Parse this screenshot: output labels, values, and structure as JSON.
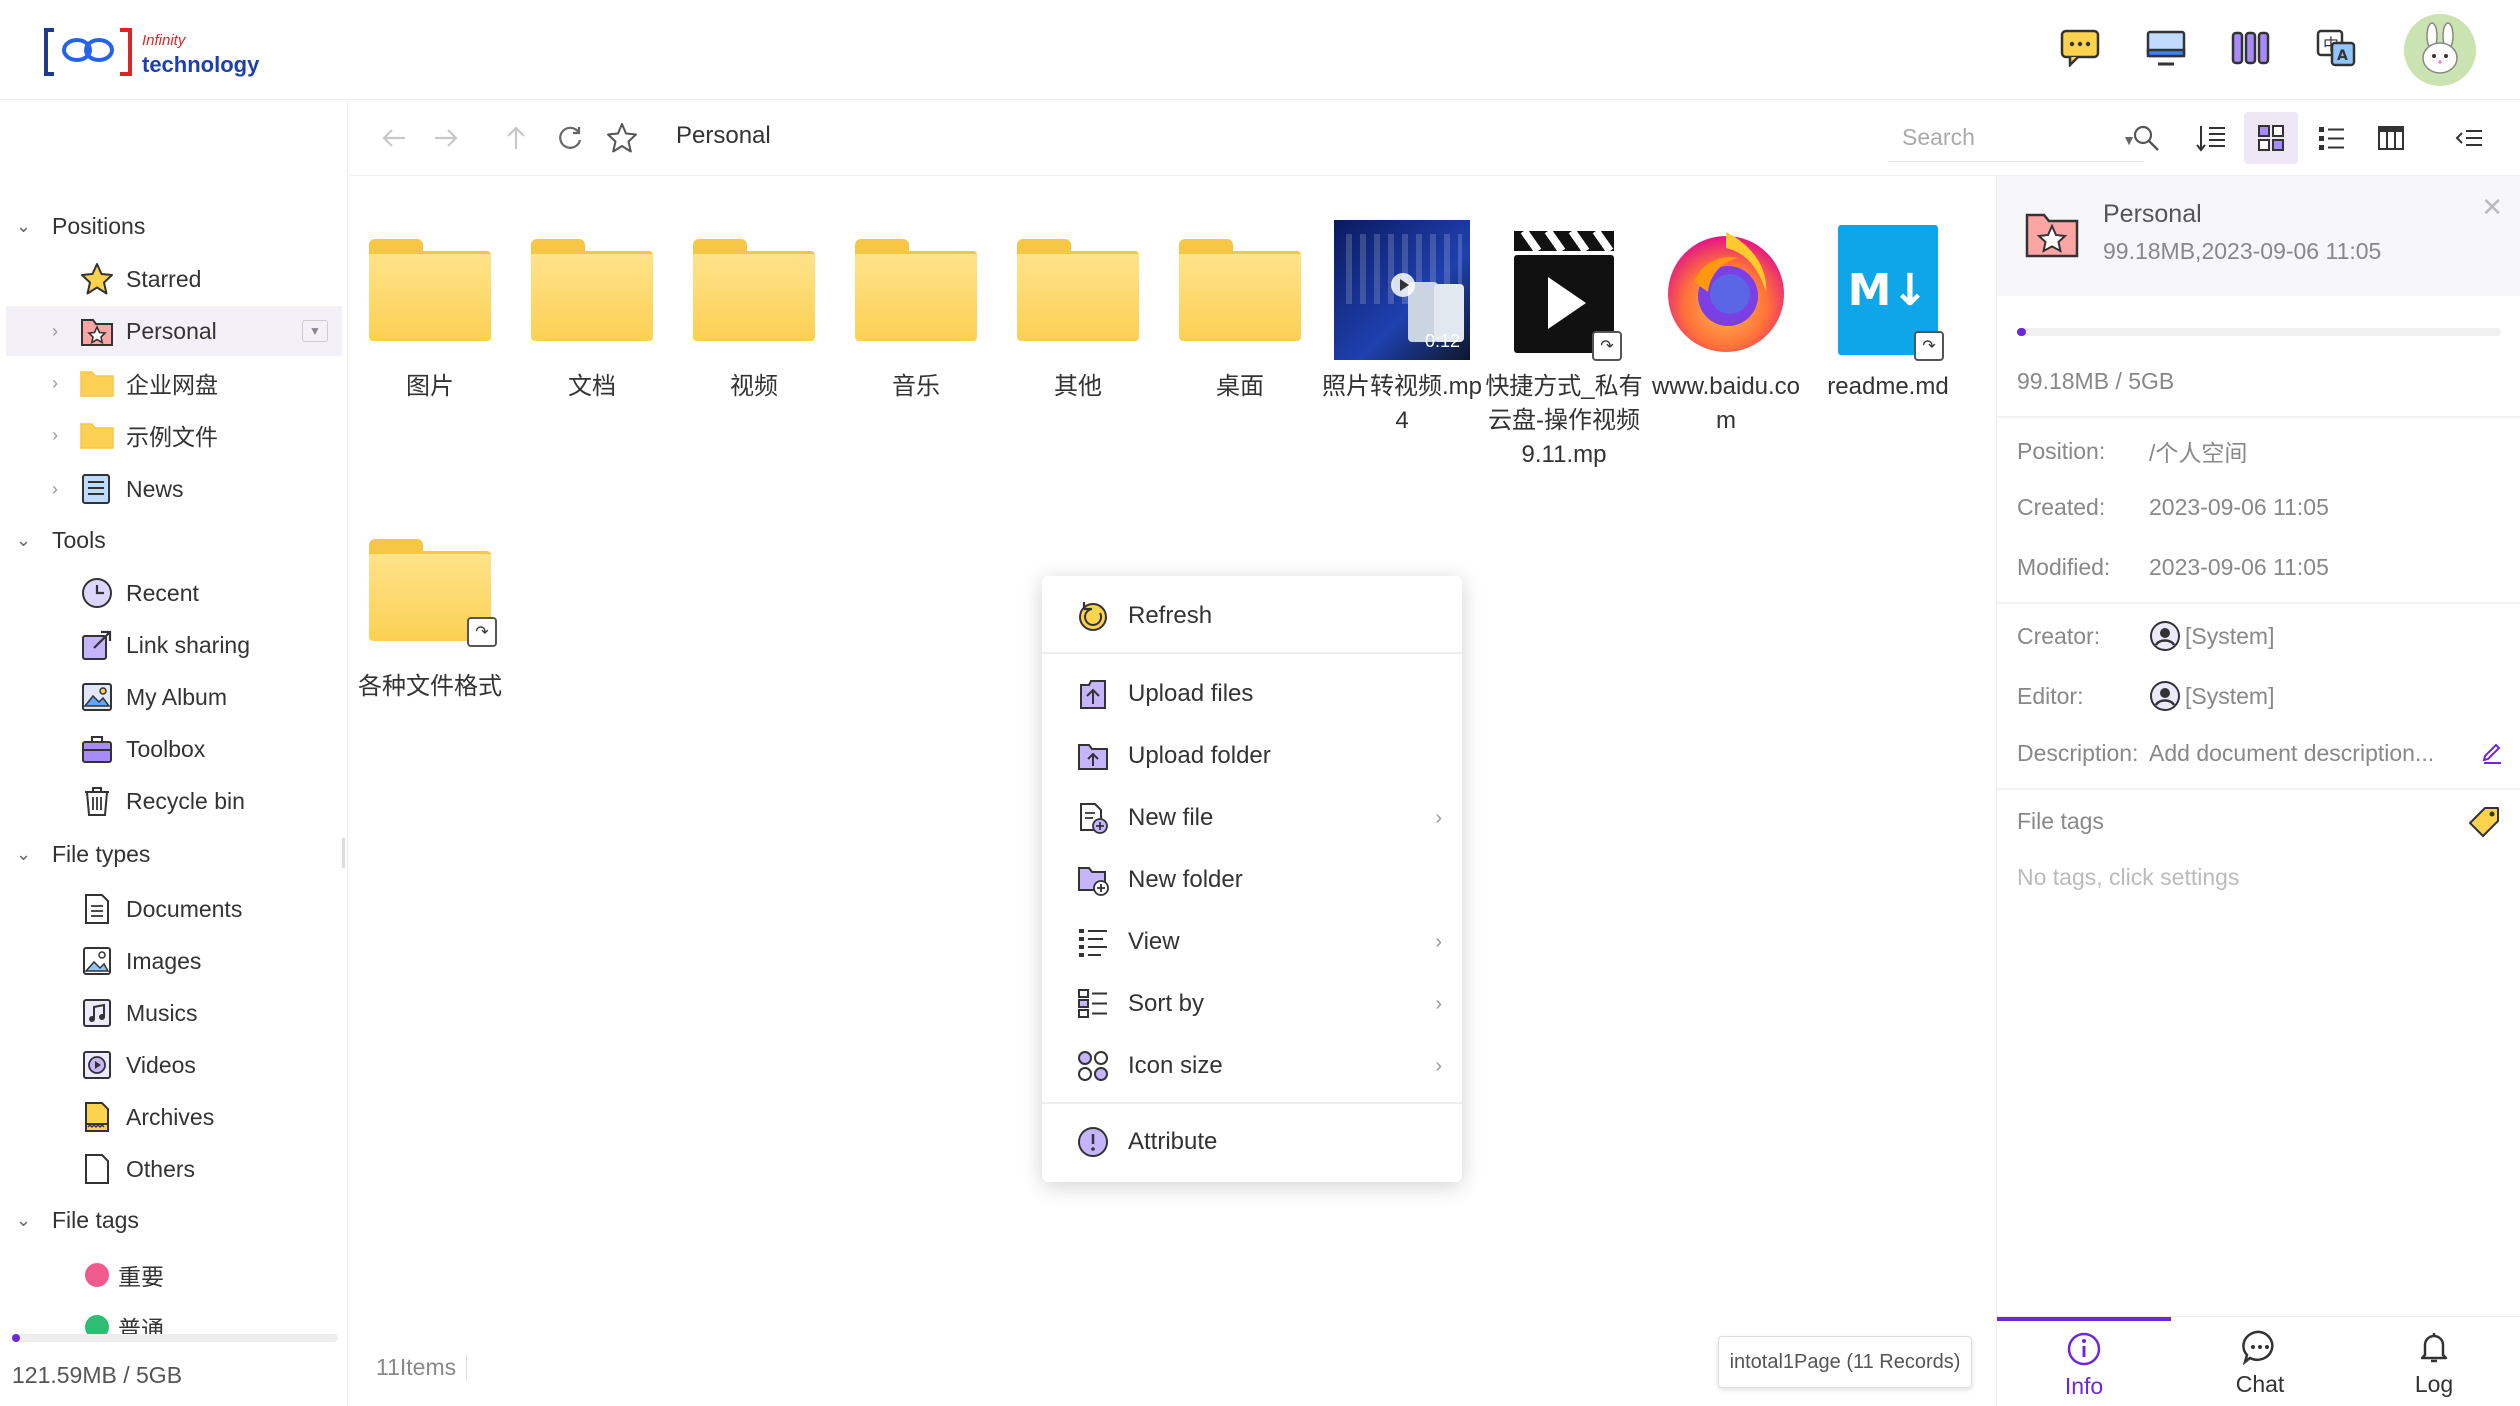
{
  "header": {
    "logo_small": "Infinity",
    "logo_large": "technology",
    "icons": [
      "message-icon",
      "desktop-icon",
      "apps-icon",
      "translate-icon"
    ],
    "avatar_icon": "rabbit-avatar"
  },
  "sidebar": {
    "positions_label": "Positions",
    "positions": [
      {
        "label": "Starred",
        "icon": "star-icon"
      },
      {
        "label": "Personal",
        "icon": "personal-star-folder-icon"
      },
      {
        "label": "企业网盘",
        "icon": "folder-icon"
      },
      {
        "label": "示例文件",
        "icon": "folder-icon"
      },
      {
        "label": "News",
        "icon": "news-icon"
      }
    ],
    "tools_label": "Tools",
    "tools": [
      {
        "label": "Recent",
        "icon": "clock-icon"
      },
      {
        "label": "Link sharing",
        "icon": "share-icon"
      },
      {
        "label": "My Album",
        "icon": "album-icon"
      },
      {
        "label": "Toolbox",
        "icon": "toolbox-icon"
      },
      {
        "label": "Recycle bin",
        "icon": "trash-icon"
      }
    ],
    "file_types_label": "File types",
    "file_types": [
      {
        "label": "Documents",
        "icon": "document-icon"
      },
      {
        "label": "Images",
        "icon": "image-icon"
      },
      {
        "label": "Musics",
        "icon": "music-icon"
      },
      {
        "label": "Videos",
        "icon": "video-icon"
      },
      {
        "label": "Archives",
        "icon": "archive-icon"
      },
      {
        "label": "Others",
        "icon": "file-icon"
      }
    ],
    "file_tags_label": "File tags",
    "file_tags": [
      {
        "label": "重要",
        "color": "#f05a8c"
      },
      {
        "label": "普通",
        "color": "#2ebd72"
      }
    ],
    "quota_text": "121.59MB / 5GB",
    "quota_fraction": 0.024
  },
  "toolbar": {
    "breadcrumb": "Personal",
    "search_placeholder": "Search"
  },
  "files": [
    {
      "name": "图片",
      "type": "folder"
    },
    {
      "name": "文档",
      "type": "folder"
    },
    {
      "name": "视频",
      "type": "folder"
    },
    {
      "name": "音乐",
      "type": "folder"
    },
    {
      "name": "其他",
      "type": "folder"
    },
    {
      "name": "桌面",
      "type": "folder"
    },
    {
      "name": "照片转视频.mp4",
      "type": "video",
      "duration": "0:12"
    },
    {
      "name": "快捷方式_私有云盘-操作视频9.11.mp",
      "type": "video-shortcut"
    },
    {
      "name": "www.baidu.com",
      "type": "url"
    },
    {
      "name": "readme.md",
      "type": "markdown"
    },
    {
      "name": "各种文件格式",
      "type": "folder-shortcut"
    }
  ],
  "footer": {
    "item_count": "11Items",
    "pager": "intotal1Page (11 Records)"
  },
  "context_menu": {
    "items": [
      {
        "label": "Refresh",
        "icon": "refresh-icon"
      },
      {
        "label": "Upload files",
        "icon": "upload-file-icon"
      },
      {
        "label": "Upload folder",
        "icon": "upload-folder-icon"
      },
      {
        "label": "New file",
        "icon": "new-file-icon",
        "submenu": true
      },
      {
        "label": "New folder",
        "icon": "new-folder-icon"
      },
      {
        "label": "View",
        "icon": "view-list-icon",
        "submenu": true
      },
      {
        "label": "Sort by",
        "icon": "sort-icon",
        "submenu": true
      },
      {
        "label": "Icon size",
        "icon": "icon-size-icon",
        "submenu": true
      },
      {
        "label": "Attribute",
        "icon": "attribute-icon"
      }
    ]
  },
  "info_panel": {
    "title": "Personal",
    "subtitle": "99.18MB,2023-09-06 11:05",
    "usage": "99.18MB / 5GB",
    "usage_fraction": 0.019,
    "position_label": "Position:",
    "position_value": "/个人空间",
    "created_label": "Created:",
    "created_value": "2023-09-06 11:05",
    "modified_label": "Modified:",
    "modified_value": "2023-09-06 11:05",
    "creator_label": "Creator:",
    "creator_value": "[System]",
    "editor_label": "Editor:",
    "editor_value": "[System]",
    "description_label": "Description:",
    "description_value": "Add document description...",
    "tags_label": "File tags",
    "tags_empty": "No tags, click settings",
    "tabs": [
      {
        "label": "Info",
        "icon": "info-icon"
      },
      {
        "label": "Chat",
        "icon": "chat-icon"
      },
      {
        "label": "Log",
        "icon": "bell-icon"
      }
    ]
  },
  "colors": {
    "accent": "#6d28d9",
    "folder": "#fbd053",
    "tag_red": "#f05a8c",
    "tag_green": "#2ebd72"
  }
}
